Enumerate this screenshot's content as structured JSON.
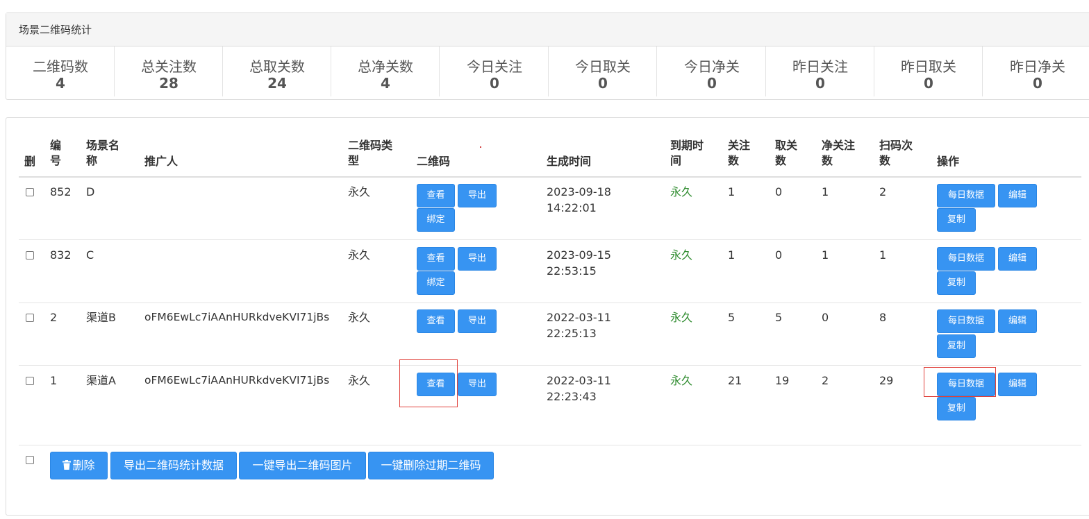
{
  "stats_panel": {
    "title": "场景二维码统计",
    "items": [
      {
        "label": "二维码数",
        "value": "4"
      },
      {
        "label": "总关注数",
        "value": "28"
      },
      {
        "label": "总取关数",
        "value": "24"
      },
      {
        "label": "总净关数",
        "value": "4"
      },
      {
        "label": "今日关注",
        "value": "0"
      },
      {
        "label": "今日取关",
        "value": "0"
      },
      {
        "label": "今日净关",
        "value": "0"
      },
      {
        "label": "昨日关注",
        "value": "0"
      },
      {
        "label": "昨日取关",
        "value": "0"
      },
      {
        "label": "昨日净关",
        "value": "0"
      }
    ]
  },
  "table": {
    "headers": {
      "del": "删",
      "id_a": "编",
      "id_b": "号",
      "name_a": "场景名",
      "name_b": "称",
      "promoter": "推广人",
      "type_a": "二维码类",
      "type_b": "型",
      "qrcode": "二维码",
      "created": "生成时间",
      "expire_a": "到期时",
      "expire_b": "间",
      "follow_a": "关注",
      "follow_b": "数",
      "unfollow_a": "取关",
      "unfollow_b": "数",
      "net_a": "净关注",
      "net_b": "数",
      "scans_a": "扫码次",
      "scans_b": "数",
      "actions": "操作"
    },
    "rows": [
      {
        "id": "852",
        "name": "D",
        "promoter": "",
        "type": "永久",
        "date": "2023-09-18",
        "time": "14:22:01",
        "expire": "永久",
        "follow": "1",
        "unfollow": "0",
        "net": "1",
        "scans": "2"
      },
      {
        "id": "832",
        "name": "C",
        "promoter": "",
        "type": "永久",
        "date": "2023-09-15",
        "time": "22:53:15",
        "expire": "永久",
        "follow": "1",
        "unfollow": "0",
        "net": "1",
        "scans": "1"
      },
      {
        "id": "2",
        "name": "渠道B",
        "promoter": "oFM6EwLc7iAAnHURkdveKVI71jBs",
        "type": "永久",
        "date": "2022-03-11",
        "time": "22:25:13",
        "expire": "永久",
        "follow": "5",
        "unfollow": "5",
        "net": "0",
        "scans": "8"
      },
      {
        "id": "1",
        "name": "渠道A",
        "promoter": "oFM6EwLc7iAAnHURkdveKVI71jBs",
        "type": "永久",
        "date": "2022-03-11",
        "time": "22:23:43",
        "expire": "永久",
        "follow": "21",
        "unfollow": "19",
        "net": "2",
        "scans": "29"
      }
    ],
    "row_buttons": {
      "view": "查看",
      "export": "导出",
      "bind": "绑定",
      "daily": "每日数据",
      "edit": "编辑",
      "copy": "复制"
    }
  },
  "footer": {
    "delete": "删除",
    "export_stats": "导出二维码统计数据",
    "export_images": "一键导出二维码图片",
    "delete_expired": "一键删除过期二维码"
  },
  "colors": {
    "button": "#3794f2",
    "expire_text": "#2e8b2e",
    "highlight_box": "#e0403a"
  },
  "icons": {
    "delete": "trash-icon"
  }
}
